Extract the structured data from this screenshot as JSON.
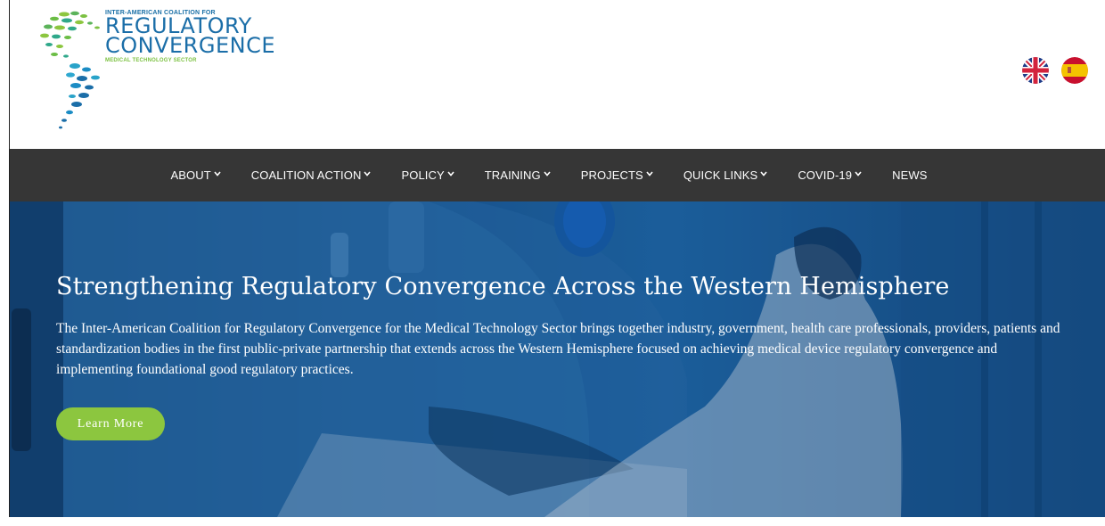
{
  "header": {
    "logo": {
      "top_line": "INTER-AMERICAN COALITION FOR",
      "line1": "REGULATORY",
      "line2": "CONVERGENCE",
      "sector": "MEDICAL TECHNOLOGY SECTOR"
    },
    "languages": [
      {
        "icon": "uk-flag-icon"
      },
      {
        "icon": "spain-flag-icon"
      }
    ]
  },
  "nav": {
    "items": [
      {
        "label": "ABOUT",
        "dropdown": true
      },
      {
        "label": "COALITION ACTION",
        "dropdown": true
      },
      {
        "label": "POLICY",
        "dropdown": true
      },
      {
        "label": "TRAINING",
        "dropdown": true
      },
      {
        "label": "PROJECTS",
        "dropdown": true
      },
      {
        "label": "QUICK LINKS",
        "dropdown": true
      },
      {
        "label": "COVID-19",
        "dropdown": true
      },
      {
        "label": "NEWS",
        "dropdown": false
      }
    ],
    "chevron": "⌄"
  },
  "hero": {
    "title": "Strengthening Regulatory Convergence Across the Western Hemisphere",
    "text": "The Inter-American Coalition for Regulatory Convergence for the Medical Technology Sector brings together industry, government, health care professionals, providers, patients and standardization bodies in the first public-private partnership that extends across the Western Hemisphere focused on achieving medical device regulatory convergence and implementing foundational good regulatory practices.",
    "button_label": "Learn More"
  },
  "colors": {
    "nav_bg": "#363636",
    "brand_blue": "#1b6ea8",
    "brand_green": "#8cc63f",
    "hero_blue": "#1d5fa0"
  }
}
